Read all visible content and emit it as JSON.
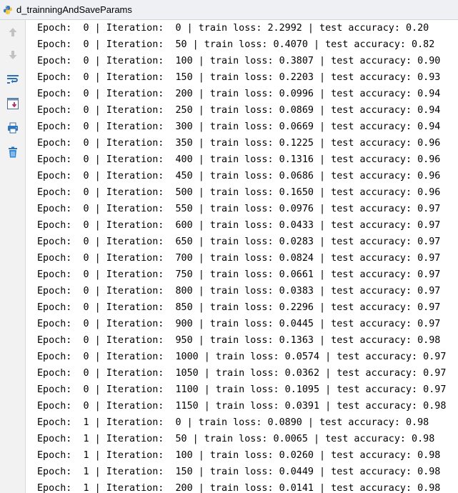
{
  "window": {
    "title": "d_trainningAndSaveParams"
  },
  "toolbar": {
    "buttons": [
      {
        "name": "scroll-up-icon"
      },
      {
        "name": "scroll-down-icon"
      },
      {
        "name": "soft-wrap-icon"
      },
      {
        "name": "scroll-to-end-icon"
      },
      {
        "name": "print-icon"
      },
      {
        "name": "clear-all-icon"
      }
    ]
  },
  "console": {
    "lines": [
      "Epoch:  0 | Iteration:  0 | train loss: 2.2992 | test accuracy: 0.20",
      "Epoch:  0 | Iteration:  50 | train loss: 0.4070 | test accuracy: 0.82",
      "Epoch:  0 | Iteration:  100 | train loss: 0.3807 | test accuracy: 0.90",
      "Epoch:  0 | Iteration:  150 | train loss: 0.2203 | test accuracy: 0.93",
      "Epoch:  0 | Iteration:  200 | train loss: 0.0996 | test accuracy: 0.94",
      "Epoch:  0 | Iteration:  250 | train loss: 0.0869 | test accuracy: 0.94",
      "Epoch:  0 | Iteration:  300 | train loss: 0.0669 | test accuracy: 0.94",
      "Epoch:  0 | Iteration:  350 | train loss: 0.1225 | test accuracy: 0.96",
      "Epoch:  0 | Iteration:  400 | train loss: 0.1316 | test accuracy: 0.96",
      "Epoch:  0 | Iteration:  450 | train loss: 0.0686 | test accuracy: 0.96",
      "Epoch:  0 | Iteration:  500 | train loss: 0.1650 | test accuracy: 0.96",
      "Epoch:  0 | Iteration:  550 | train loss: 0.0976 | test accuracy: 0.97",
      "Epoch:  0 | Iteration:  600 | train loss: 0.0433 | test accuracy: 0.97",
      "Epoch:  0 | Iteration:  650 | train loss: 0.0283 | test accuracy: 0.97",
      "Epoch:  0 | Iteration:  700 | train loss: 0.0824 | test accuracy: 0.97",
      "Epoch:  0 | Iteration:  750 | train loss: 0.0661 | test accuracy: 0.97",
      "Epoch:  0 | Iteration:  800 | train loss: 0.0383 | test accuracy: 0.97",
      "Epoch:  0 | Iteration:  850 | train loss: 0.2296 | test accuracy: 0.97",
      "Epoch:  0 | Iteration:  900 | train loss: 0.0445 | test accuracy: 0.97",
      "Epoch:  0 | Iteration:  950 | train loss: 0.1363 | test accuracy: 0.98",
      "Epoch:  0 | Iteration:  1000 | train loss: 0.0574 | test accuracy: 0.97",
      "Epoch:  0 | Iteration:  1050 | train loss: 0.0362 | test accuracy: 0.97",
      "Epoch:  0 | Iteration:  1100 | train loss: 0.1095 | test accuracy: 0.97",
      "Epoch:  0 | Iteration:  1150 | train loss: 0.0391 | test accuracy: 0.98",
      "Epoch:  1 | Iteration:  0 | train loss: 0.0890 | test accuracy: 0.98",
      "Epoch:  1 | Iteration:  50 | train loss: 0.0065 | test accuracy: 0.98",
      "Epoch:  1 | Iteration:  100 | train loss: 0.0260 | test accuracy: 0.98",
      "Epoch:  1 | Iteration:  150 | train loss: 0.0449 | test accuracy: 0.98",
      "Epoch:  1 | Iteration:  200 | train loss: 0.0141 | test accuracy: 0.98"
    ]
  }
}
